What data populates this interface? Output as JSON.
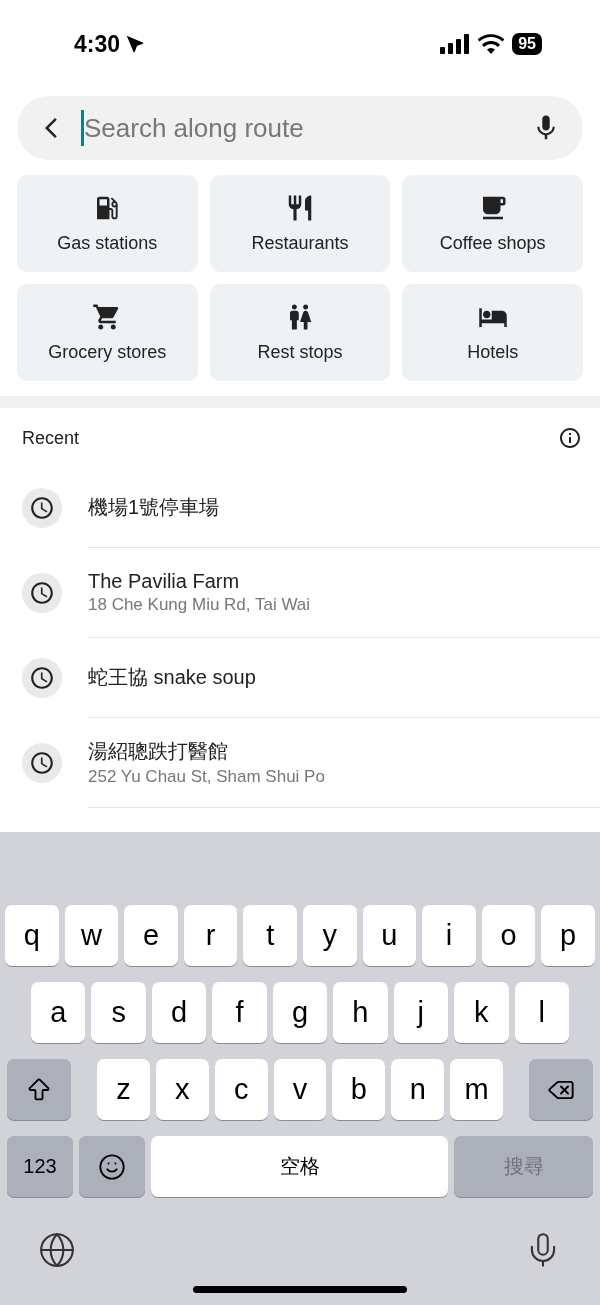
{
  "status_bar": {
    "time": "4:30",
    "battery": "95"
  },
  "search": {
    "placeholder": "Search along route"
  },
  "categories": [
    {
      "label": "Gas stations",
      "kind": "gas"
    },
    {
      "label": "Restaurants",
      "kind": "restaurant"
    },
    {
      "label": "Coffee shops",
      "kind": "coffee"
    },
    {
      "label": "Grocery stores",
      "kind": "grocery"
    },
    {
      "label": "Rest stops",
      "kind": "restroom"
    },
    {
      "label": "Hotels",
      "kind": "hotel"
    }
  ],
  "recent": {
    "title": "Recent",
    "items": [
      {
        "title": "機場1號停車場"
      },
      {
        "title": "The Pavilia Farm",
        "subtitle": "18 Che Kung Miu Rd, Tai Wai"
      },
      {
        "title": "蛇王協 snake soup"
      },
      {
        "title": "湯紹聰跌打醫館",
        "subtitle": "252 Yu Chau St, Sham Shui Po"
      }
    ]
  },
  "keyboard": {
    "rows": [
      [
        {
          "kind": "letter",
          "label": "q"
        },
        {
          "kind": "letter",
          "label": "w"
        },
        {
          "kind": "letter",
          "label": "e"
        },
        {
          "kind": "letter",
          "label": "r"
        },
        {
          "kind": "letter",
          "label": "t"
        },
        {
          "kind": "letter",
          "label": "y"
        },
        {
          "kind": "letter",
          "label": "u"
        },
        {
          "kind": "letter",
          "label": "i"
        },
        {
          "kind": "letter",
          "label": "o"
        },
        {
          "kind": "letter",
          "label": "p"
        }
      ],
      [
        {
          "kind": "letter",
          "label": "a"
        },
        {
          "kind": "letter",
          "label": "s"
        },
        {
          "kind": "letter",
          "label": "d"
        },
        {
          "kind": "letter",
          "label": "f"
        },
        {
          "kind": "letter",
          "label": "g"
        },
        {
          "kind": "letter",
          "label": "h"
        },
        {
          "kind": "letter",
          "label": "j"
        },
        {
          "kind": "letter",
          "label": "k"
        },
        {
          "kind": "letter",
          "label": "l"
        }
      ],
      [
        {
          "kind": "shift"
        },
        {
          "kind": "letter",
          "label": "z"
        },
        {
          "kind": "letter",
          "label": "x"
        },
        {
          "kind": "letter",
          "label": "c"
        },
        {
          "kind": "letter",
          "label": "v"
        },
        {
          "kind": "letter",
          "label": "b"
        },
        {
          "kind": "letter",
          "label": "n"
        },
        {
          "kind": "letter",
          "label": "m"
        },
        {
          "kind": "backspace"
        }
      ]
    ],
    "mode_key": "123",
    "space_key": "空格",
    "search_key": {
      "label": "搜尋",
      "disabled": true
    }
  }
}
